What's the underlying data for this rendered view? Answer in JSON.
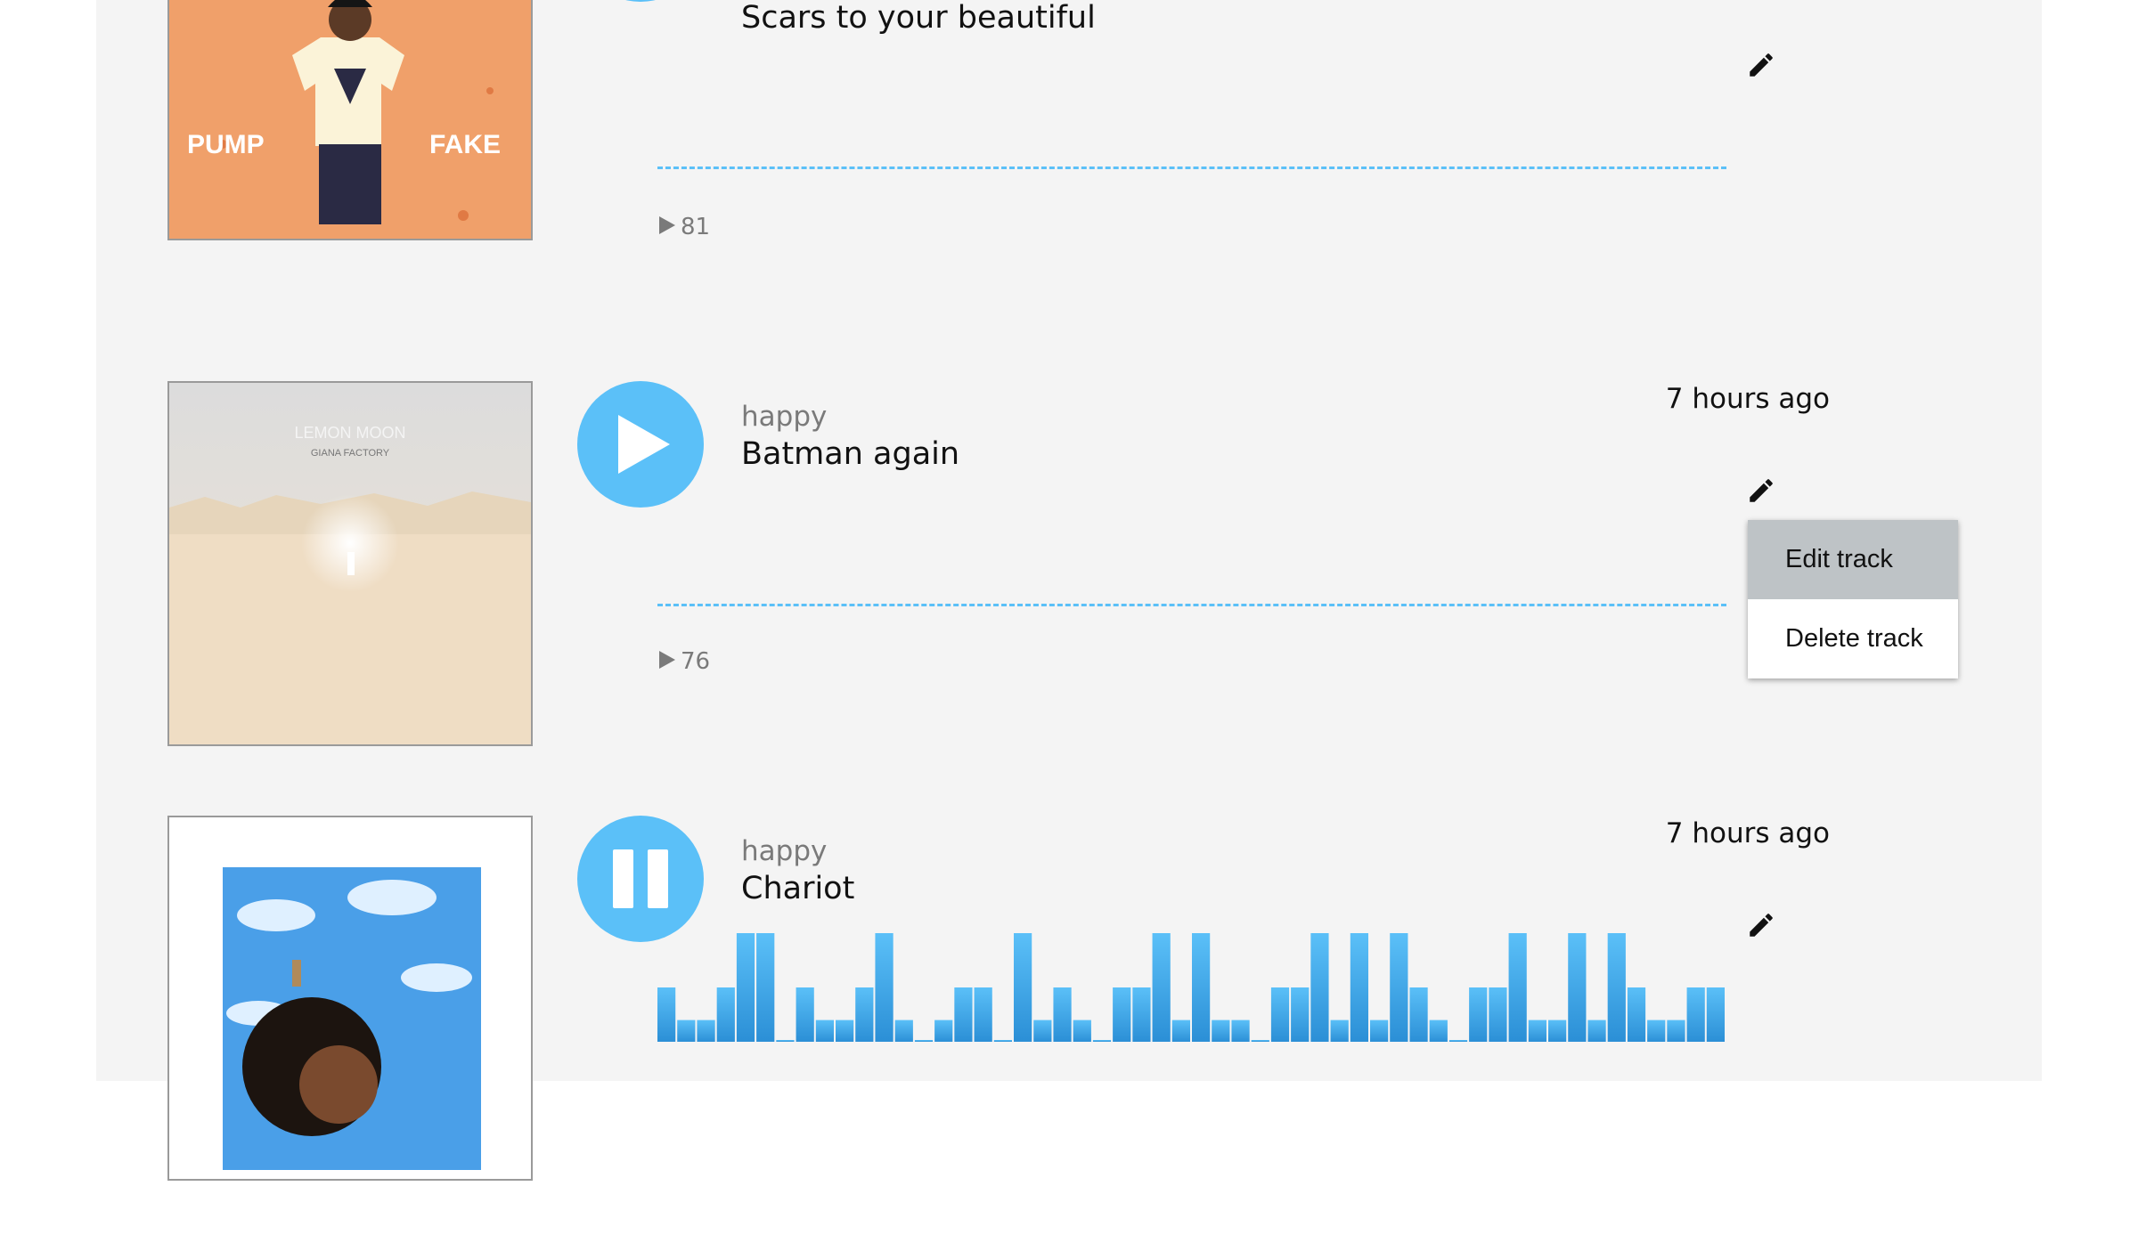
{
  "colors": {
    "accent": "#5bc0f8",
    "panel": "#f4f4f4",
    "menu_hover": "#bec3c6"
  },
  "tracks": [
    {
      "genre": "",
      "title": "Scars to your beautiful",
      "time": "",
      "plays": "81",
      "state": "stopped",
      "cover_text": {
        "left": "PUMP",
        "right": "FAKE"
      }
    },
    {
      "genre": "happy",
      "title": "Batman again",
      "time": "7 hours ago",
      "plays": "76",
      "state": "stopped",
      "cover_text": {
        "line1": "LEMON MOON",
        "line2": "GIANA FACTORY"
      }
    },
    {
      "genre": "happy",
      "title": "Chariot",
      "time": "7 hours ago",
      "plays": "",
      "state": "playing",
      "waveform_levels": [
        0.5,
        0.2,
        0.2,
        0.5,
        1,
        1,
        0,
        0.5,
        0.2,
        0.2,
        0.5,
        1,
        0.2,
        0,
        0.2,
        0.5,
        0.5,
        0,
        1,
        0.2,
        0.5,
        0.2,
        0,
        0.5,
        0.5,
        1,
        0.2,
        1,
        0.2,
        0.2,
        0,
        0.5,
        0.5,
        1,
        0.2,
        1,
        0.2,
        1,
        0.5,
        0.2,
        0,
        0.5,
        0.5,
        1,
        0.2,
        0.2,
        1,
        0.2,
        1,
        0.5,
        0.2,
        0.2,
        0.5,
        0.5
      ]
    }
  ],
  "menu": {
    "items": [
      "Edit track",
      "Delete track"
    ],
    "highlighted": 0
  },
  "icons": {
    "edit": "pencil-icon",
    "play": "play-icon",
    "pause": "pause-icon",
    "plays": "play-count-icon"
  }
}
